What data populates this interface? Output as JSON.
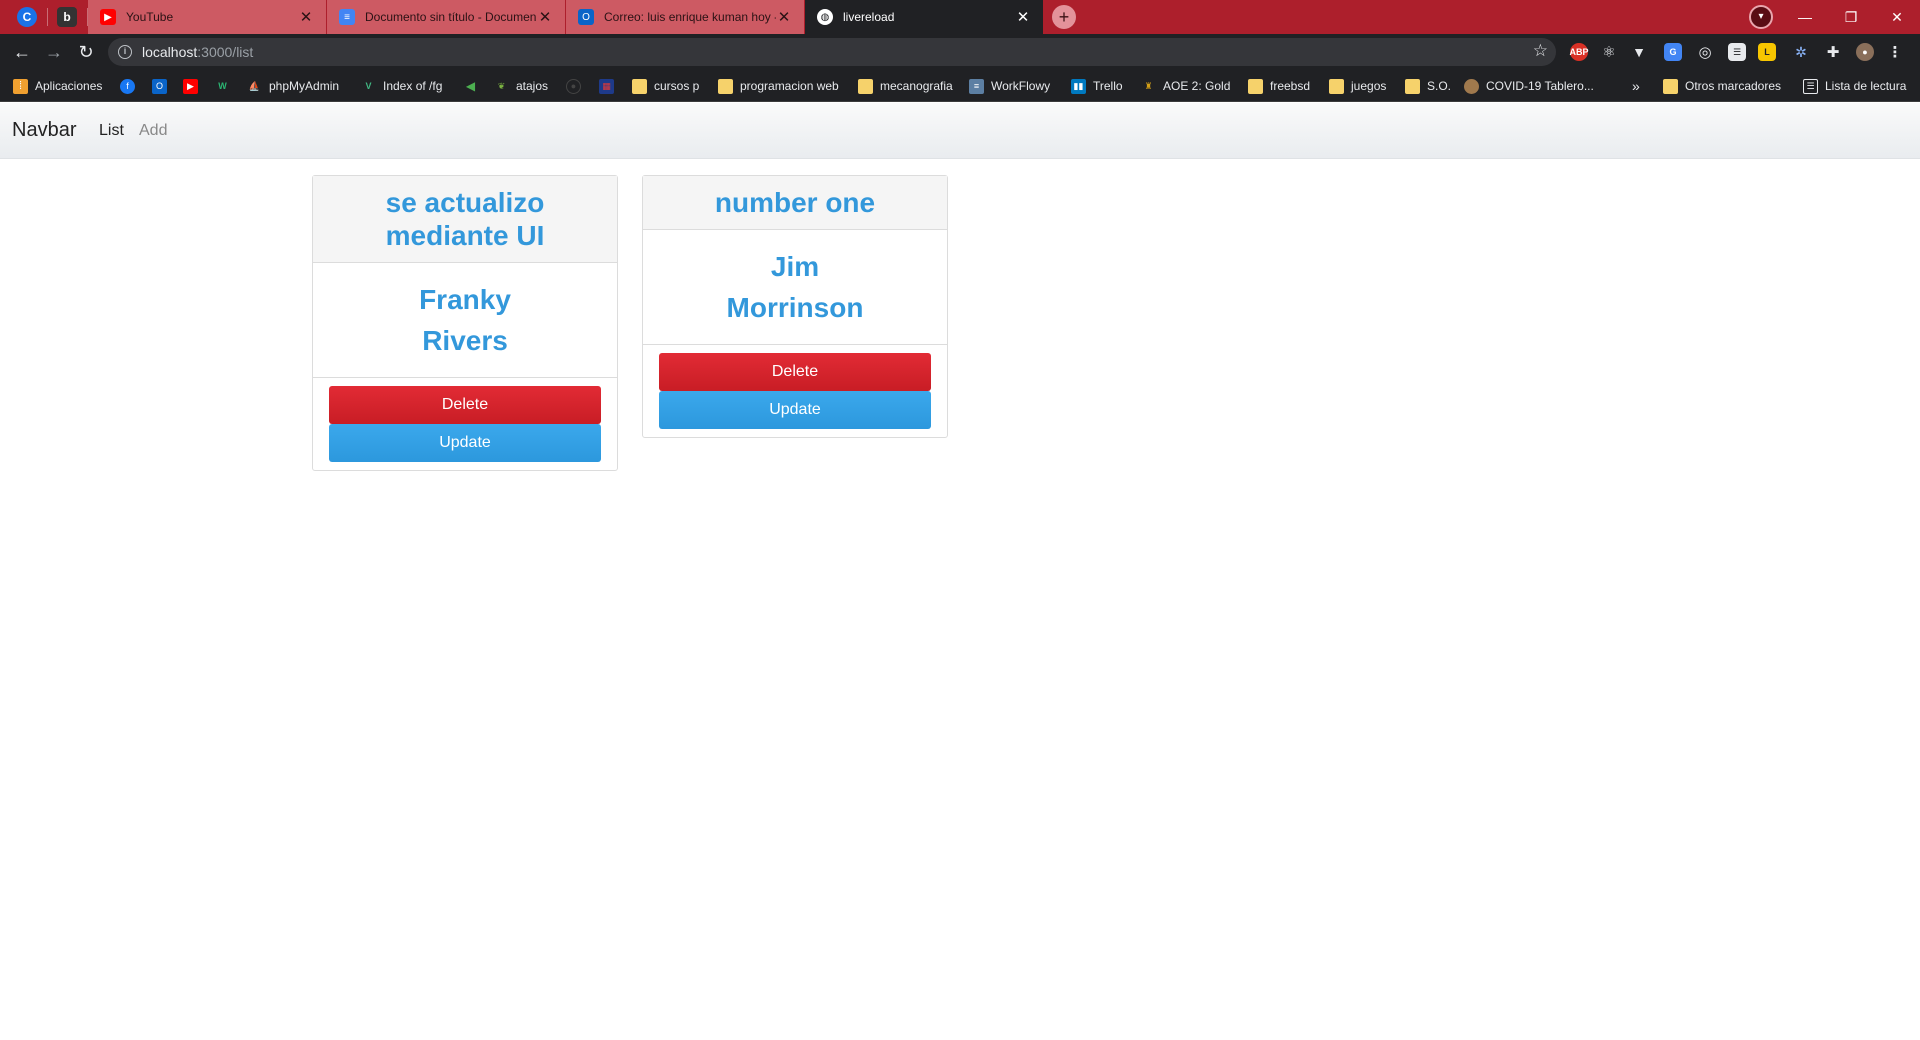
{
  "browser": {
    "tabs": [
      {
        "title": "YouTube",
        "favicon": "youtube-icon"
      },
      {
        "title": "Documento sin título - Documen",
        "favicon": "docs-icon"
      },
      {
        "title": "Correo: luis enrique kuman hoy -",
        "favicon": "outlook-icon"
      },
      {
        "title": "livereload",
        "favicon": "globe-icon"
      }
    ],
    "address": {
      "host": "localhost",
      "path": ":3000/list"
    },
    "bookmarks": {
      "apps": "Aplicaciones",
      "phpmyadmin": "phpMyAdmin",
      "index": "Index of /fg",
      "atajos": "atajos",
      "cursos": "cursos p",
      "programacion": "programacion web",
      "mecanografia": "mecanografia",
      "workflowy": "WorkFlowy",
      "trello": "Trello",
      "aoe": "AOE 2: Gold",
      "freebsd": "freebsd",
      "juegos": "juegos",
      "so": "S.O.",
      "covid": "COVID-19 Tablero...",
      "more": "»",
      "otros": "Otros marcadores",
      "lectura": "Lista de lectura"
    },
    "colors": {
      "tab_strip": "#ad1f2c",
      "toolbar": "#202124"
    }
  },
  "navbar": {
    "brand": "Navbar",
    "links": [
      {
        "label": "List",
        "active": true
      },
      {
        "label": "Add",
        "active": false
      }
    ]
  },
  "cards": [
    {
      "title": "se actualizo mediante UI",
      "first_name": "Franky",
      "last_name": "Rivers",
      "delete_label": "Delete",
      "update_label": "Update"
    },
    {
      "title": "number one",
      "first_name": "Jim",
      "last_name": "Morrinson",
      "delete_label": "Delete",
      "update_label": "Update"
    }
  ],
  "colors": {
    "accent": "#3398db",
    "delete": "#d42530",
    "update": "#3ba8ec"
  }
}
